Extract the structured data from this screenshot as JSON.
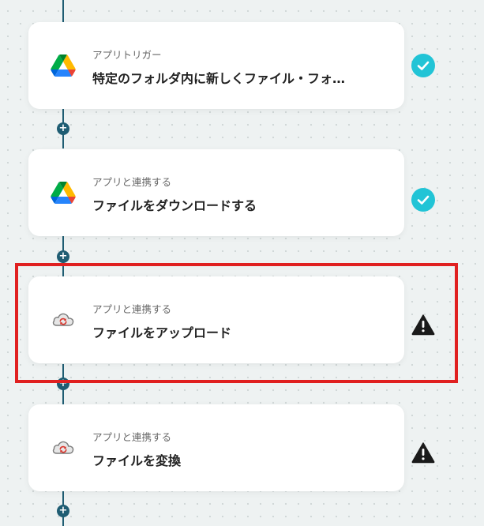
{
  "flow": {
    "steps": [
      {
        "kind": "アプリトリガー",
        "title": "特定のフォルダ内に新しくファイル・フォ…",
        "icon": "google-drive-icon",
        "status": "complete",
        "status_icon": "check-icon"
      },
      {
        "kind": "アプリと連携する",
        "title": "ファイルをダウンロードする",
        "icon": "google-drive-icon",
        "status": "complete",
        "status_icon": "check-icon"
      },
      {
        "kind": "アプリと連携する",
        "title": "ファイルをアップロード",
        "icon": "cloud-convert-icon",
        "status": "warning",
        "status_icon": "warning-icon"
      },
      {
        "kind": "アプリと連携する",
        "title": "ファイルを変換",
        "icon": "cloud-convert-icon",
        "status": "warning",
        "status_icon": "warning-icon"
      }
    ],
    "add_step_symbol": "+",
    "highlighted_step": 3
  },
  "colors": {
    "background": "#eef2f2",
    "connector": "#1f5d73",
    "check": "#22c4d6",
    "warning": "#1a1a1a",
    "highlight": "#e02020"
  }
}
